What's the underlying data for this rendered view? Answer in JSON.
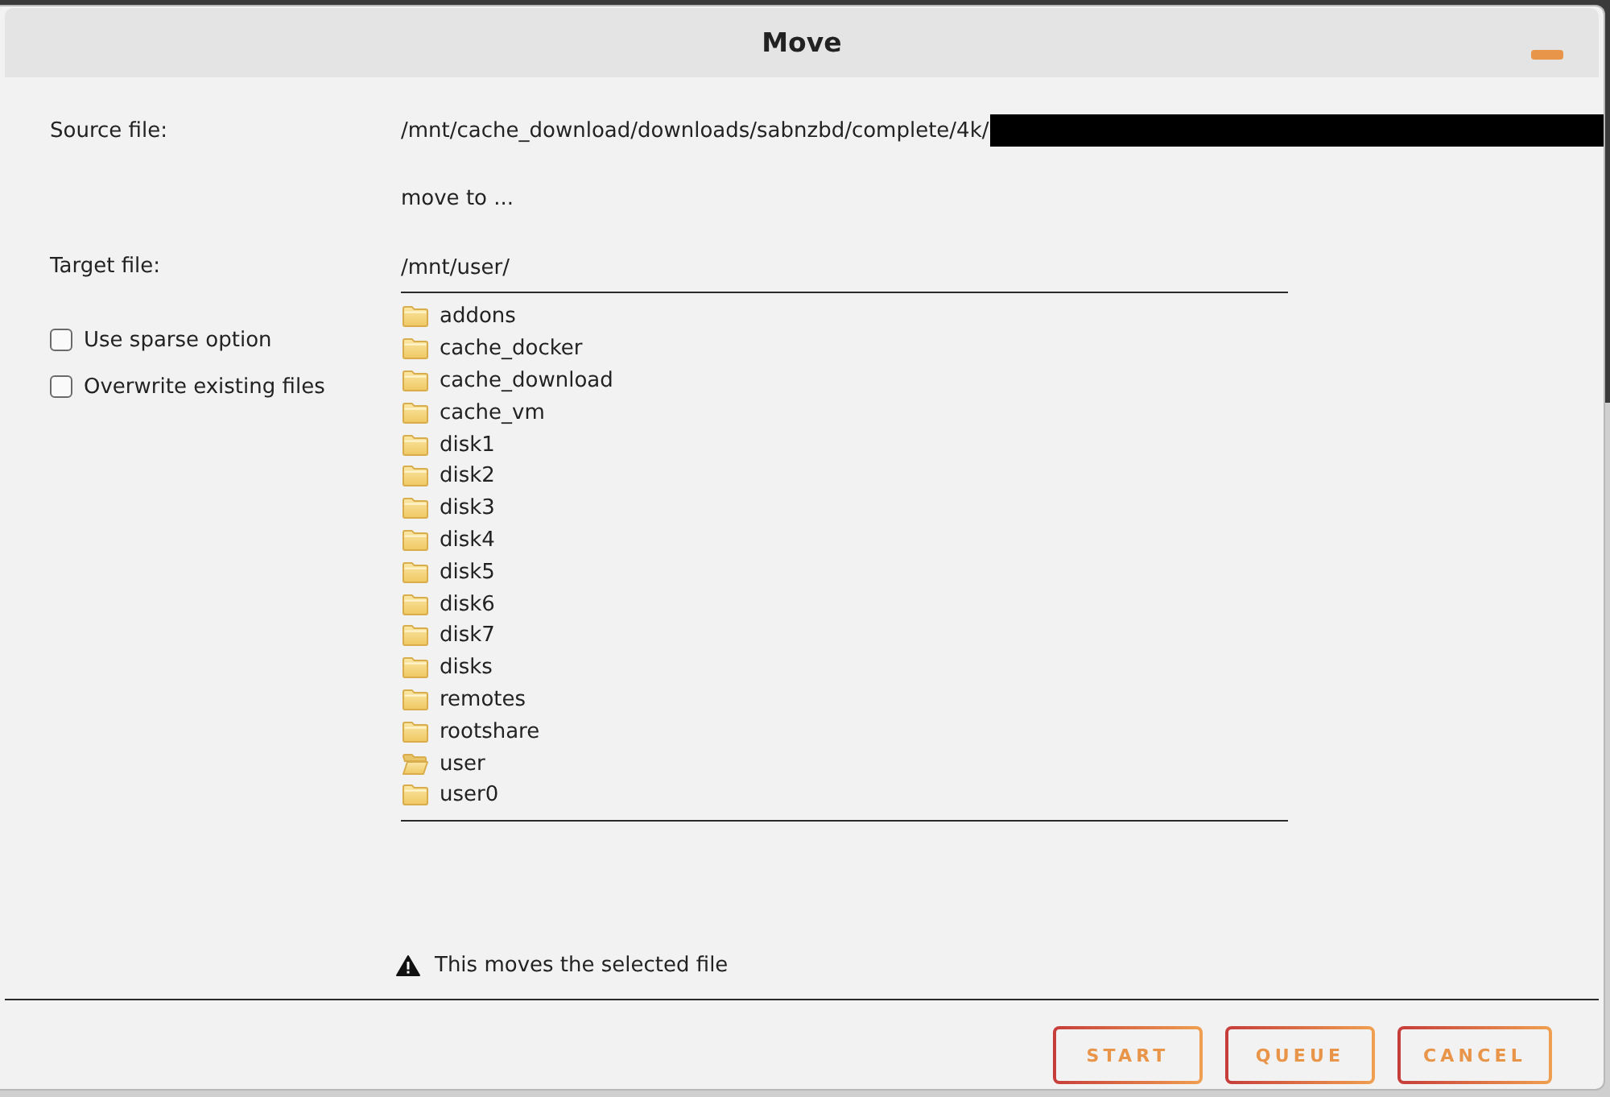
{
  "dialog": {
    "title": "Move"
  },
  "source": {
    "label": "Source file:",
    "path": "/mnt/cache_download/downloads/sabnzbd/complete/4k/",
    "redacted": true
  },
  "move_to": "move to ...",
  "target": {
    "label": "Target file:",
    "value": "/mnt/user/"
  },
  "options": [
    {
      "label": "Use sparse option",
      "checked": false
    },
    {
      "label": "Overwrite existing files",
      "checked": false
    }
  ],
  "folders": [
    {
      "name": "addons",
      "open": false
    },
    {
      "name": "cache_docker",
      "open": false
    },
    {
      "name": "cache_download",
      "open": false
    },
    {
      "name": "cache_vm",
      "open": false
    },
    {
      "name": "disk1",
      "open": false
    },
    {
      "name": "disk2",
      "open": false
    },
    {
      "name": "disk3",
      "open": false
    },
    {
      "name": "disk4",
      "open": false
    },
    {
      "name": "disk5",
      "open": false
    },
    {
      "name": "disk6",
      "open": false
    },
    {
      "name": "disk7",
      "open": false
    },
    {
      "name": "disks",
      "open": false
    },
    {
      "name": "remotes",
      "open": false
    },
    {
      "name": "rootshare",
      "open": false
    },
    {
      "name": "user",
      "open": true
    },
    {
      "name": "user0",
      "open": false
    }
  ],
  "warning": "This moves the selected file",
  "buttons": [
    "START",
    "QUEUE",
    "CANCEL"
  ]
}
